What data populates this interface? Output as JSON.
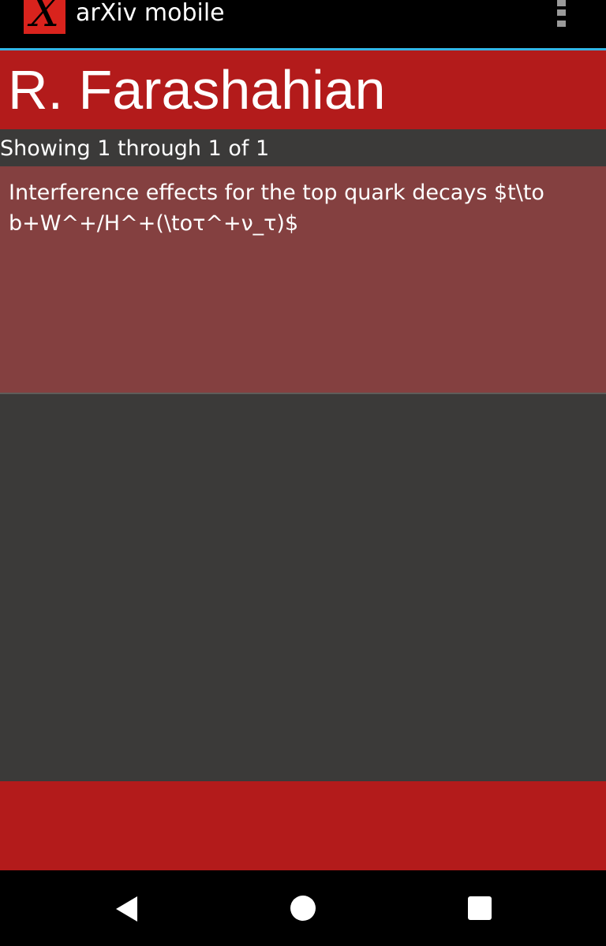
{
  "action_bar": {
    "logo_text": "X",
    "title": "arXiv mobile",
    "overflow_icon": "overflow-menu-icon"
  },
  "author": {
    "name": "R. Farashahian"
  },
  "results": {
    "count_text": "Showing 1 through 1 of 1",
    "items": [
      {
        "title": "Interference effects for the top quark decays $t\\to b+W^+/H^+(\\toτ^+ν_τ)$"
      }
    ]
  },
  "nav_bar": {
    "back_icon": "back-icon",
    "home_icon": "home-icon",
    "recents_icon": "recents-icon"
  },
  "colors": {
    "action_bar_bg": "#000000",
    "accent_line": "#33b5e5",
    "brand_red": "#b31b1b",
    "item_bg": "#844040",
    "page_bg": "#3b3a39"
  }
}
